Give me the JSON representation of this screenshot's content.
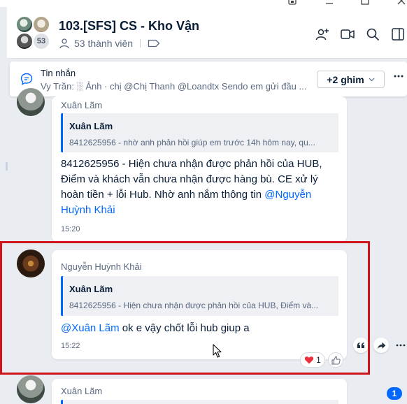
{
  "header": {
    "group_name": "103.[SFS] CS - Kho Vận",
    "member_count_badge": "53",
    "members_label": "53 thành viên"
  },
  "pinned": {
    "title": "Tin nhắn",
    "preview": "Vy Trần: ░ Ảnh · chị @Chị Thanh @Loandtx Sendo em gửi đầu ...",
    "pins_button": "+2 ghim"
  },
  "messages": [
    {
      "sender": "Xuân Lãm",
      "quote_author": "Xuân Lãm",
      "quote_text": "8412625956 - nhờ anh phản hồi giúp em trước 14h hôm nay, qu...",
      "text": "8412625956 - Hiện chưa nhận được phản hồi của HUB, Điểm và khách vẫn chưa nhận được hàng bù. CE xử lý hoàn tiền + lỗi Hub. Nhờ anh nắm thông tin ",
      "mention": "@Nguyễn Huỳnh Khải",
      "time": "15:20"
    },
    {
      "sender": "Nguyễn Huỳnh Khải",
      "quote_author": "Xuân Lãm",
      "quote_text": "8412625956 - Hiện chưa nhận được phản hồi của HUB, Điểm và...",
      "mention": "@Xuân Lãm",
      "text": " ok e vậy chốt lỗi hub giup a",
      "time": "15:22",
      "reaction_count": "1"
    },
    {
      "sender": "Xuân Lãm"
    }
  ],
  "unread_badge": "1",
  "colors": {
    "accent": "#0068ff",
    "selection_border": "#d0141b",
    "background": "#e9ecf1"
  }
}
